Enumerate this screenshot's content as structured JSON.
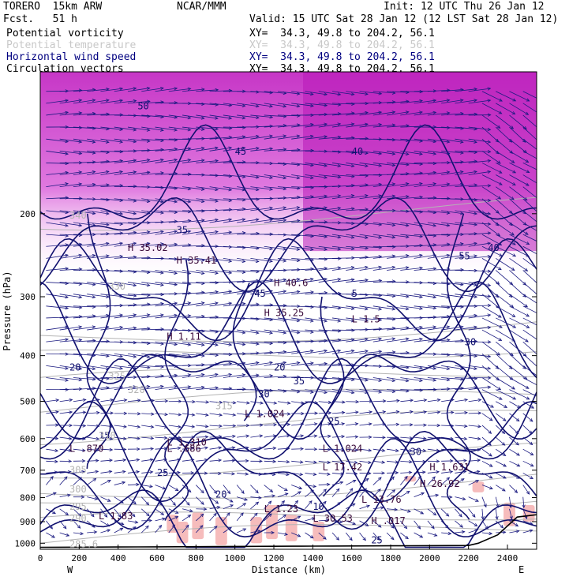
{
  "header": {
    "model": "TORERO  15km ARW",
    "org": "NCAR/MMM",
    "init": "Init: 12 UTC Thu 26 Jan 12",
    "fcst": "Fcst.   51 h",
    "valid": "Valid: 15 UTC Sat 28 Jan 12 (12 LST Sat 28 Jan 12)",
    "fields": [
      {
        "label": "Potential vorticity",
        "color": "#000000",
        "xy": "XY=  34.3, 49.8 to 204.2, 56.1"
      },
      {
        "label": "Potential temperature",
        "color": "#c8c8c8",
        "xy": "XY=  34.3, 49.8 to 204.2, 56.1"
      },
      {
        "label": "Horizontal wind speed",
        "color": "#000080",
        "xy": "XY=  34.3, 49.8 to 204.2, 56.1"
      },
      {
        "label": "Circulation vectors",
        "color": "#000000",
        "xy": "XY=  34.3, 49.8 to 204.2, 56.1"
      }
    ]
  },
  "chart_data": {
    "type": "cross-section",
    "xlabel": "Distance (km)",
    "ylabel": "Pressure (hPa)",
    "x_ticks": [
      "0",
      "200",
      "400",
      "600",
      "800",
      "1000",
      "1200",
      "1400",
      "1600",
      "1800",
      "2000",
      "2200",
      "2400"
    ],
    "y_ticks": [
      "200",
      "300",
      "400",
      "500",
      "600",
      "700",
      "800",
      "900",
      "1000"
    ],
    "xlim": [
      0,
      2550
    ],
    "ylim": [
      1030,
      100
    ],
    "y_scale": "log",
    "endpoints": {
      "left": "W",
      "right": "E"
    },
    "colors": {
      "wind_contour": "#10106e",
      "theta_contour": "#b4b4b4",
      "pv_fill_high": "#cc33cc",
      "pv_fill_low": "#f4b0b0",
      "vectors": "#1a1a80",
      "frame": "#000000"
    },
    "wind_speed_labels": [
      "20",
      "25",
      "30",
      "35",
      "40",
      "45",
      "50",
      "55",
      "30",
      "25",
      "20",
      "15",
      "10",
      "5",
      "35",
      "40",
      "45",
      "30",
      "25",
      "20"
    ],
    "theta_labels": [
      "340",
      "320",
      "310",
      "305",
      "300",
      "295",
      "290",
      "285.6",
      "325",
      "330",
      "315"
    ],
    "extrema_labels": [
      {
        "type": "L",
        "value": "1.024"
      },
      {
        "type": "L",
        "value": ".870"
      },
      {
        "type": "L",
        "value": "1.310"
      },
      {
        "type": "L",
        "value": ".686"
      },
      {
        "type": "L",
        "value": "1.024"
      },
      {
        "type": "L",
        "value": "17.42"
      },
      {
        "type": "H",
        "value": "1.631"
      },
      {
        "type": "H",
        "value": "26.92"
      },
      {
        "type": "L",
        "value": "13.76"
      },
      {
        "type": "L",
        "value": "1.23"
      },
      {
        "type": "L",
        "value": "1.83"
      },
      {
        "type": "H",
        "value": "1.11"
      },
      {
        "type": "H",
        "value": "35.02"
      },
      {
        "type": "H",
        "value": "35.41"
      },
      {
        "type": "H",
        "value": "40.6"
      },
      {
        "type": "H",
        "value": "35.25"
      },
      {
        "type": "L",
        "value": "1.5"
      },
      {
        "type": "H",
        "value": ".017"
      },
      {
        "type": "L",
        "value": "30.53"
      }
    ]
  }
}
